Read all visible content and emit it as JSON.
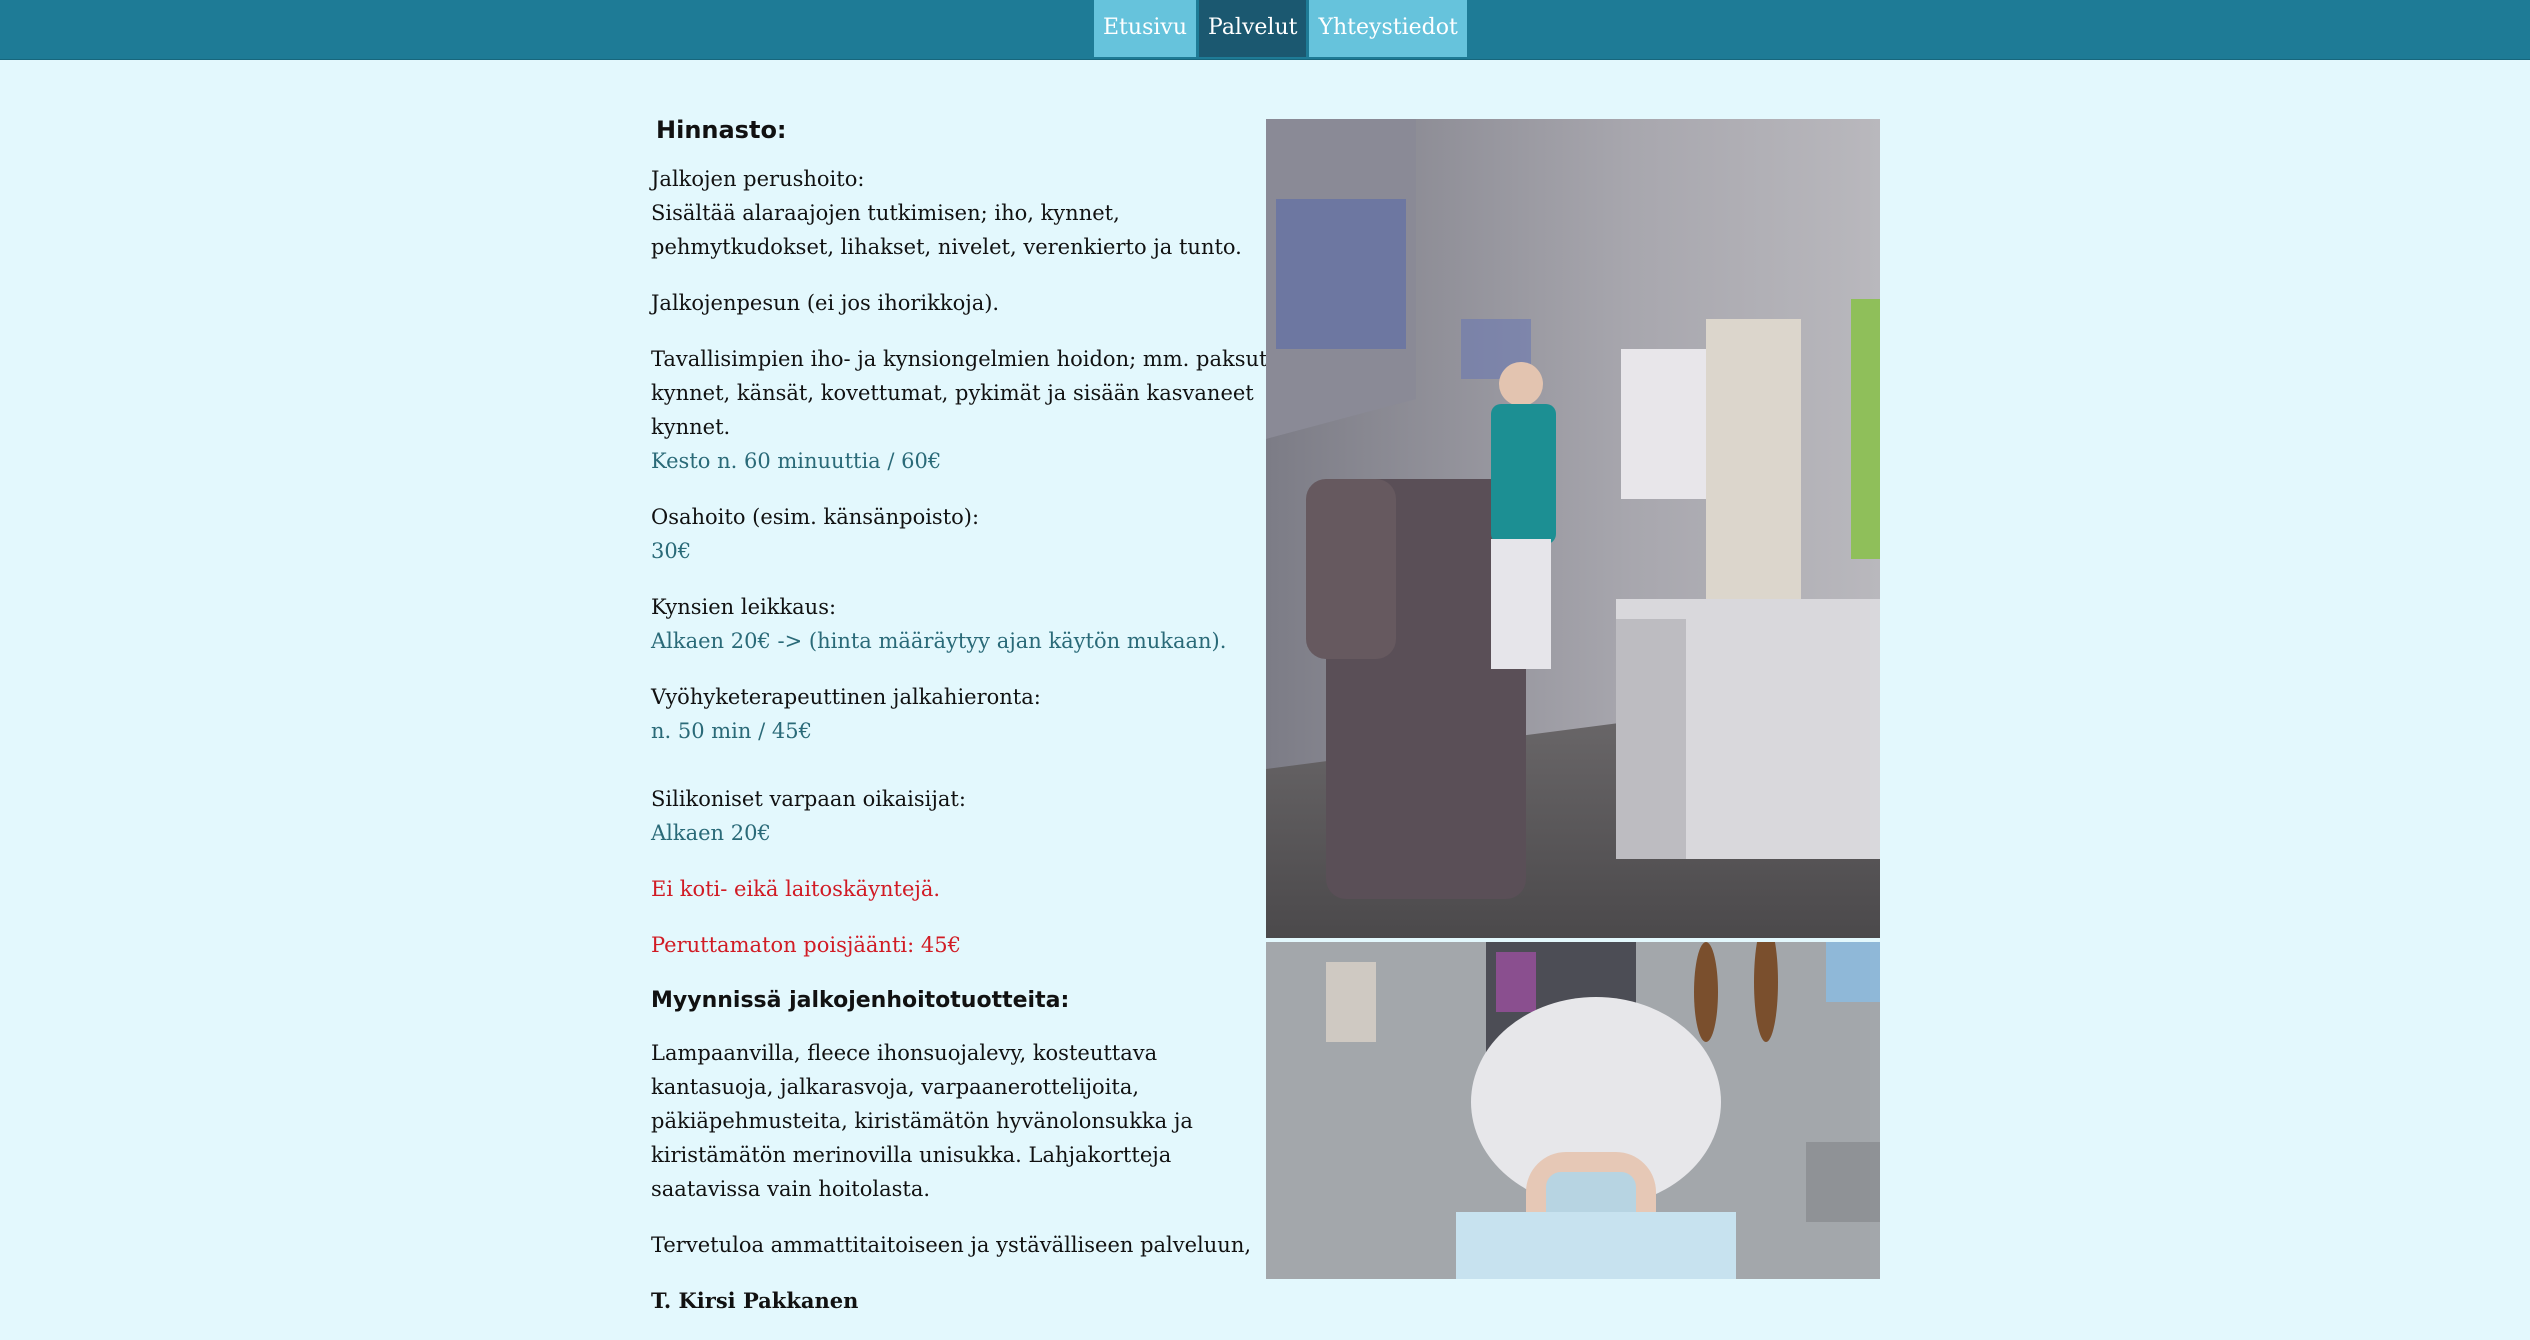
{
  "nav": {
    "items": [
      {
        "label": "Etusivu"
      },
      {
        "label": "Palvelut"
      },
      {
        "label": "Yhteystiedot"
      }
    ],
    "active": "Palvelut"
  },
  "pricing": {
    "title": "Hinnasto:",
    "basic": {
      "name": "Jalkojen perushoito:",
      "desc1": "Sisältää alaraajojen tutkimisen; iho, kynnet, pehmytkudokset, lihakset, nivelet, verenkierto ja tunto.",
      "desc2": "Jalkojenpesun (ei jos ihorikkoja).",
      "desc3": "Tavallisimpien iho- ja kynsiongelmien hoidon; mm. paksut kynnet, känsät, kovettumat, pykimät ja sisään kasvaneet kynnet.",
      "price": "Kesto n. 60 minuuttia / 60€"
    },
    "partial": {
      "name": "Osahoito (esim. känsänpoisto):",
      "price": "30€"
    },
    "nails": {
      "name": "Kynsien leikkaus:",
      "price": "Alkaen 20€ -> (hinta määräytyy ajan käytön mukaan)."
    },
    "reflex": {
      "name": "Vyöhyketerapeuttinen jalkahieronta:",
      "price": "n. 50 min / 45€"
    },
    "silicone": {
      "name": "Silikoniset varpaan oikaisijat:",
      "price": "Alkaen 20€"
    },
    "notice1": "Ei koti- eikä laitoskäyntejä.",
    "notice2": "Peruttamaton poisjäänti: 45€"
  },
  "products": {
    "title": "Myynnissä jalkojenhoitotuotteita:",
    "desc": "Lampaanvilla, fleece ihonsuojalevy, kosteuttava kantasuoja, jalkarasvoja, varpaanerottelijoita, päkiäpehmusteita, kiristämätön hyvänolonsukka ja kiristämätön merinovilla unisukka.  Lahjakortteja saatavissa vain hoitolasta.",
    "welcome": "Tervetuloa ammattitaitoiseen ja ystävälliseen palveluun,",
    "signature": "T. Kirsi Pakkanen"
  },
  "colors": {
    "header": "#1e7b96",
    "nav_button": "#66c3dc",
    "nav_active": "#1b5870",
    "background": "#e3f8fd",
    "price_text": "#2a6a78",
    "alert_text": "#d11b24"
  }
}
